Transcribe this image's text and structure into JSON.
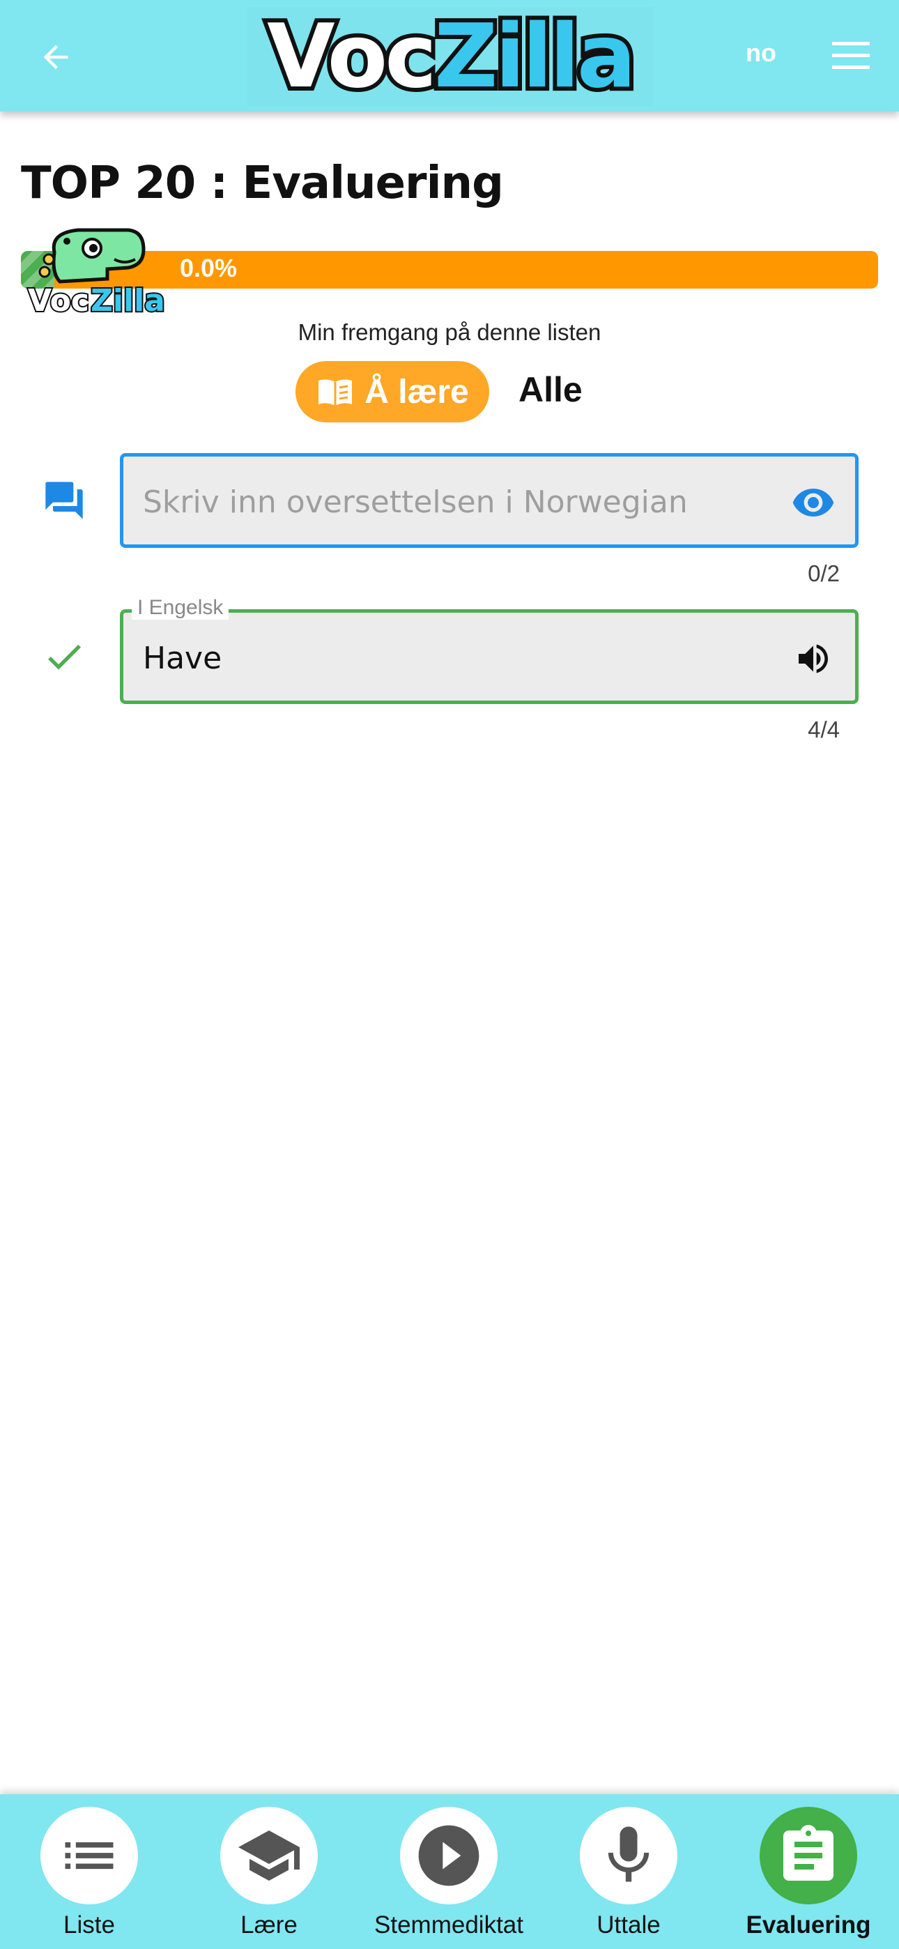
{
  "header": {
    "logo_part1": "Voc",
    "logo_part2": "Zilla",
    "language": "no",
    "back_icon": "arrow-left-icon",
    "menu_icon": "hamburger-menu-icon"
  },
  "page": {
    "title": "TOP 20 : Evaluering"
  },
  "progress": {
    "percent_label": "0.0%",
    "fraction": 0.0,
    "caption": "Min fremgang på denne listen",
    "mascot_text_part1": "Voc",
    "mascot_text_part2": "Zilla"
  },
  "filter": {
    "active_label": "Å lære",
    "other_label": "Alle"
  },
  "question": {
    "placeholder": "Skriv inn oversettelsen i Norwegian",
    "counter": "0/2",
    "icon": "chat-icon",
    "trailing_icon": "eye-icon"
  },
  "answer": {
    "legend": "I Engelsk",
    "value": "Have",
    "counter": "4/4",
    "icon": "check-icon",
    "trailing_icon": "speaker-icon"
  },
  "bottom_nav": {
    "items": [
      {
        "label": "Liste",
        "icon": "list-icon"
      },
      {
        "label": "Lære",
        "icon": "graduation-cap-icon"
      },
      {
        "label": "Stemmediktat",
        "icon": "play-icon"
      },
      {
        "label": "Uttale",
        "icon": "microphone-icon"
      },
      {
        "label": "Evaluering",
        "icon": "clipboard-icon",
        "active": true
      }
    ]
  },
  "colors": {
    "header_bg": "#80e6f0",
    "progress_bg": "#ff9800",
    "active_chip": "#ffa726",
    "question_border": "#2196f3",
    "answer_border": "#4caf50",
    "nav_active": "#43b049"
  }
}
